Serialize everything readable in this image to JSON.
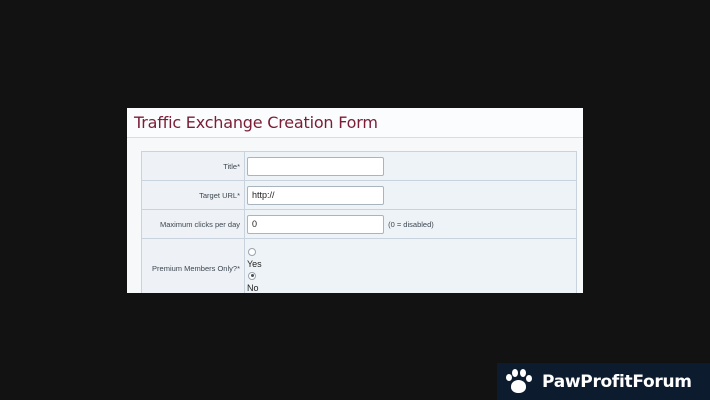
{
  "form": {
    "title": "Traffic Exchange Creation Form",
    "fields": {
      "title": {
        "label": "Title*",
        "value": ""
      },
      "target_url": {
        "label": "Target URL*",
        "value": "http://"
      },
      "max_clicks": {
        "label": "Maximum clicks per day",
        "value": "0",
        "hint": "(0 = disabled)"
      },
      "premium": {
        "label": "Premium Members Only?*",
        "options": [
          {
            "label": "Yes",
            "checked": false
          },
          {
            "label": "No",
            "checked": true
          }
        ]
      }
    }
  },
  "watermark": {
    "brand": "PawProfitForum",
    "icon": "paw-icon"
  },
  "colors": {
    "title": "#7a1d35",
    "background": "#121212",
    "panel": "#f6f8fa",
    "watermark_bg": "#0d1b2e"
  }
}
